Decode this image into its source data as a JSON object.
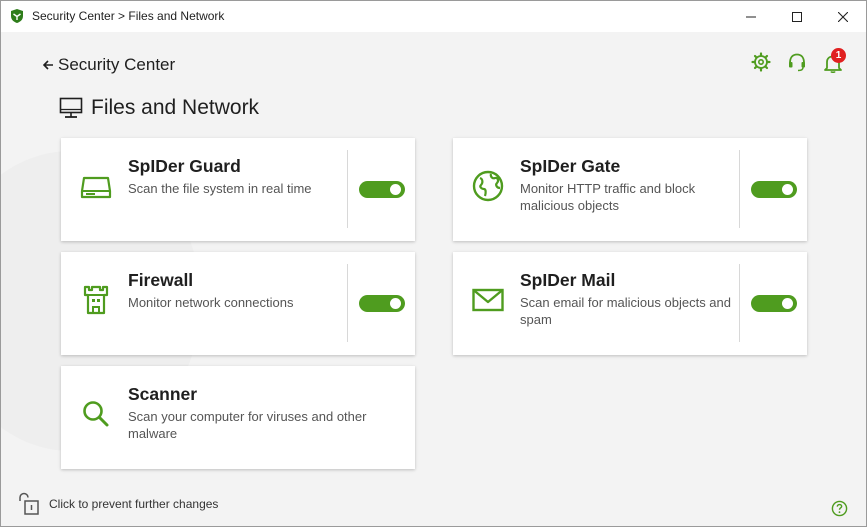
{
  "window": {
    "title": "Security Center > Files and Network"
  },
  "nav": {
    "back_label": "Security Center"
  },
  "header_icons": {
    "settings": "gear-icon",
    "support": "headset-icon",
    "notifications": "bell-icon",
    "notification_count": "1"
  },
  "page": {
    "title": "Files and Network",
    "icon": "monitor-icon"
  },
  "cards": [
    {
      "title": "SpIDer Guard",
      "description": "Scan the file system in real time",
      "icon": "hard-drive-icon",
      "enabled": true
    },
    {
      "title": "SpIDer Gate",
      "description": "Monitor HTTP traffic and block malicious objects",
      "icon": "globe-icon",
      "enabled": true
    },
    {
      "title": "Firewall",
      "description": "Monitor network connections",
      "icon": "castle-tower-icon",
      "enabled": true
    },
    {
      "title": "SpIDer Mail",
      "description": "Scan email for malicious objects and spam",
      "icon": "envelope-icon",
      "enabled": true
    },
    {
      "title": "Scanner",
      "description": "Scan your computer for viruses and other malware",
      "icon": "magnifier-icon"
    }
  ],
  "footer": {
    "lock_label": "Click to prevent further changes",
    "lock_icon": "unlocked-padlock-icon",
    "help_icon": "question-circle-icon"
  },
  "colors": {
    "accent": "#4f9c1f",
    "badge": "#e02020",
    "background": "#f3f3f3",
    "card": "#ffffff"
  }
}
